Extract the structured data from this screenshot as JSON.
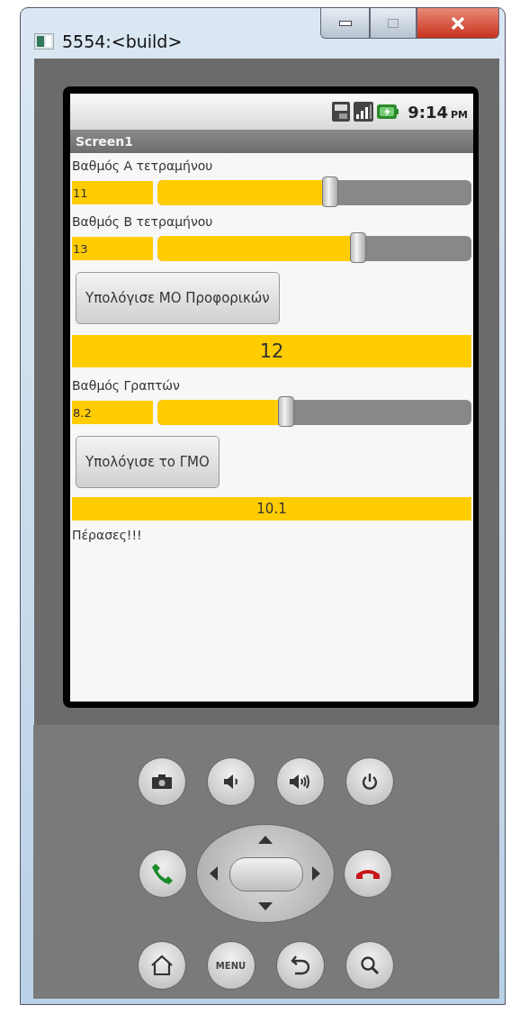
{
  "window": {
    "title": "5554:<build>"
  },
  "status_bar": {
    "time": "9:14",
    "meridiem": "PM"
  },
  "screen": {
    "title": "Screen1",
    "items": [
      {
        "kind": "slider",
        "label": "Βαθμός Α τετραμήνου",
        "value": "11",
        "level": 0.55
      },
      {
        "kind": "slider",
        "label": "Βαθμός Β τετραμήνου",
        "value": "13",
        "level": 0.64
      },
      {
        "kind": "button",
        "label": "Υπολόγισε ΜΟ Προφορικών"
      },
      {
        "kind": "result",
        "text": "12",
        "emphasized": true
      },
      {
        "kind": "slider",
        "label": "Βαθμός Γραπτών",
        "value": "8.2",
        "level": 0.41
      },
      {
        "kind": "button",
        "label": "Υπολόγισε το ΓΜΟ"
      },
      {
        "kind": "result",
        "text": "10.1",
        "emphasized": false
      },
      {
        "kind": "text",
        "text": "Πέρασες!!!"
      }
    ]
  },
  "keypad": {
    "menu_label": "MENU"
  }
}
